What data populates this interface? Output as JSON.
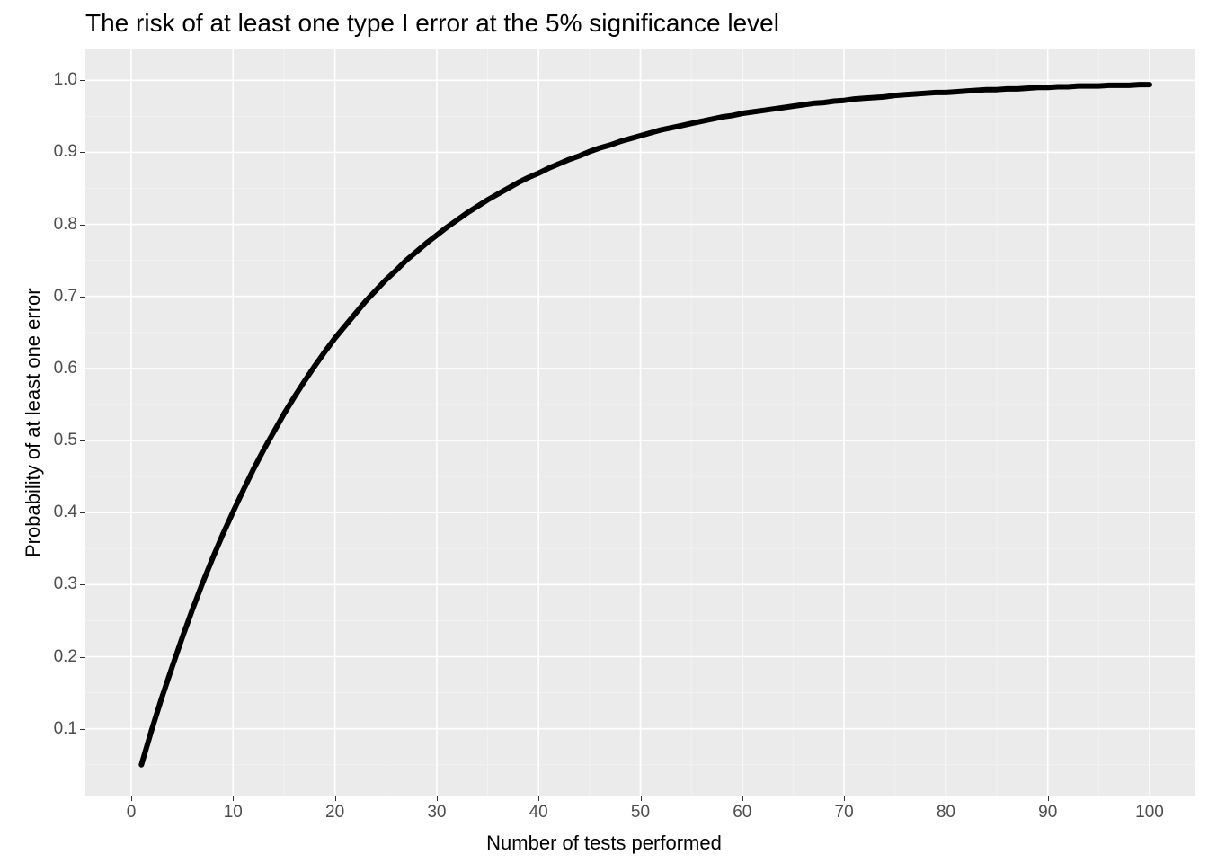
{
  "chart_data": {
    "type": "line",
    "title": "The risk of at least one type I error at the 5% significance level",
    "xlabel": "Number of tests performed",
    "ylabel": "Probability of at least one error",
    "xlim": [
      0,
      100
    ],
    "ylim": [
      0.05,
      1.0
    ],
    "x_ticks": [
      0,
      10,
      20,
      30,
      40,
      50,
      60,
      70,
      80,
      90,
      100
    ],
    "y_ticks": [
      0.1,
      0.2,
      0.3,
      0.4,
      0.5,
      0.6,
      0.7,
      0.8,
      0.9,
      1.0
    ],
    "x": [
      1,
      2,
      3,
      4,
      5,
      6,
      7,
      8,
      9,
      10,
      11,
      12,
      13,
      14,
      15,
      16,
      17,
      18,
      19,
      20,
      21,
      22,
      23,
      24,
      25,
      26,
      27,
      28,
      29,
      30,
      31,
      32,
      33,
      34,
      35,
      36,
      37,
      38,
      39,
      40,
      41,
      42,
      43,
      44,
      45,
      46,
      47,
      48,
      49,
      50,
      51,
      52,
      53,
      54,
      55,
      56,
      57,
      58,
      59,
      60,
      61,
      62,
      63,
      64,
      65,
      66,
      67,
      68,
      69,
      70,
      71,
      72,
      73,
      74,
      75,
      76,
      77,
      78,
      79,
      80,
      81,
      82,
      83,
      84,
      85,
      86,
      87,
      88,
      89,
      90,
      91,
      92,
      93,
      94,
      95,
      96,
      97,
      98,
      99,
      100
    ],
    "y": [
      0.05,
      0.098,
      0.143,
      0.185,
      0.226,
      0.265,
      0.302,
      0.337,
      0.37,
      0.401,
      0.431,
      0.46,
      0.487,
      0.512,
      0.537,
      0.56,
      0.582,
      0.603,
      0.623,
      0.642,
      0.659,
      0.676,
      0.693,
      0.708,
      0.723,
      0.736,
      0.75,
      0.762,
      0.774,
      0.785,
      0.796,
      0.806,
      0.816,
      0.825,
      0.834,
      0.842,
      0.85,
      0.858,
      0.865,
      0.871,
      0.878,
      0.884,
      0.89,
      0.895,
      0.901,
      0.906,
      0.91,
      0.915,
      0.919,
      0.923,
      0.927,
      0.931,
      0.934,
      0.937,
      0.94,
      0.943,
      0.946,
      0.949,
      0.951,
      0.954,
      0.956,
      0.958,
      0.96,
      0.962,
      0.964,
      0.966,
      0.968,
      0.969,
      0.971,
      0.972,
      0.974,
      0.975,
      0.976,
      0.977,
      0.979,
      0.98,
      0.981,
      0.982,
      0.983,
      0.983,
      0.984,
      0.985,
      0.986,
      0.987,
      0.987,
      0.988,
      0.988,
      0.989,
      0.99,
      0.99,
      0.991,
      0.991,
      0.992,
      0.992,
      0.992,
      0.993,
      0.993,
      0.993,
      0.994,
      0.994
    ],
    "grid": true,
    "colors": {
      "panel_bg": "#EBEBEB",
      "grid_major": "#FFFFFF",
      "grid_minor": "#F3F3F3",
      "line": "#000000",
      "tick_text": "#4D4D4D"
    }
  }
}
